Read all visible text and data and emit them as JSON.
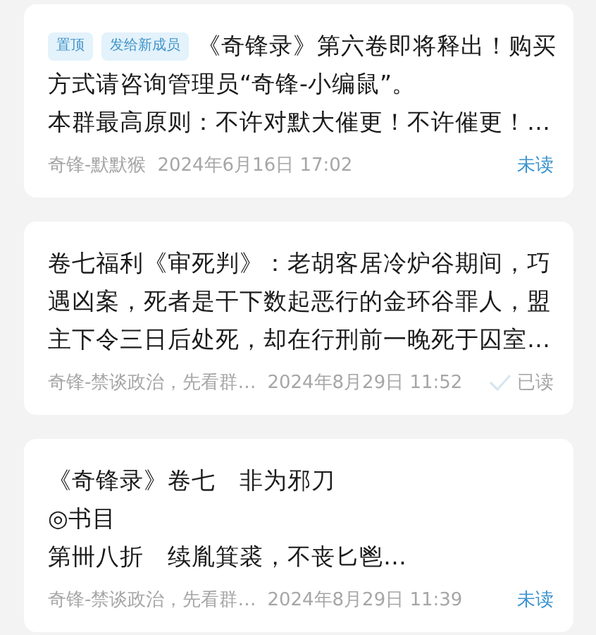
{
  "posts": [
    {
      "tags": [
        "置顶",
        "发给新成员"
      ],
      "lines": [
        "《奇锋录》第六卷即将释出！购买",
        "方式请咨询管理员“奇锋-小编鼠”。",
        "本群最高原则：不许对默大催更！不许催更！…"
      ],
      "author": "奇锋-默默猴",
      "date": "2024年6月16日 17:02",
      "read": false,
      "status": "未读"
    },
    {
      "lines": [
        "卷七福利《审死判》：老胡客居冷炉谷期间，巧",
        "遇凶案，死者是干下数起恶行的金环谷罪人，盟",
        "主下令三日后处死，却在行刑前一晚死于囚室…"
      ],
      "author": "奇锋-禁谈政治，先看群…",
      "date": "2024年8月29日 11:52",
      "read": true,
      "status": "已读"
    },
    {
      "lines": [
        "《奇锋录》卷七　非为邪刀",
        "◎书目",
        "第卌八折　续胤箕裘，不丧匕鬯…"
      ],
      "author": "奇锋-禁谈政治，先看群…",
      "date": "2024年8月29日 11:39",
      "read": false,
      "status": "未读"
    }
  ]
}
